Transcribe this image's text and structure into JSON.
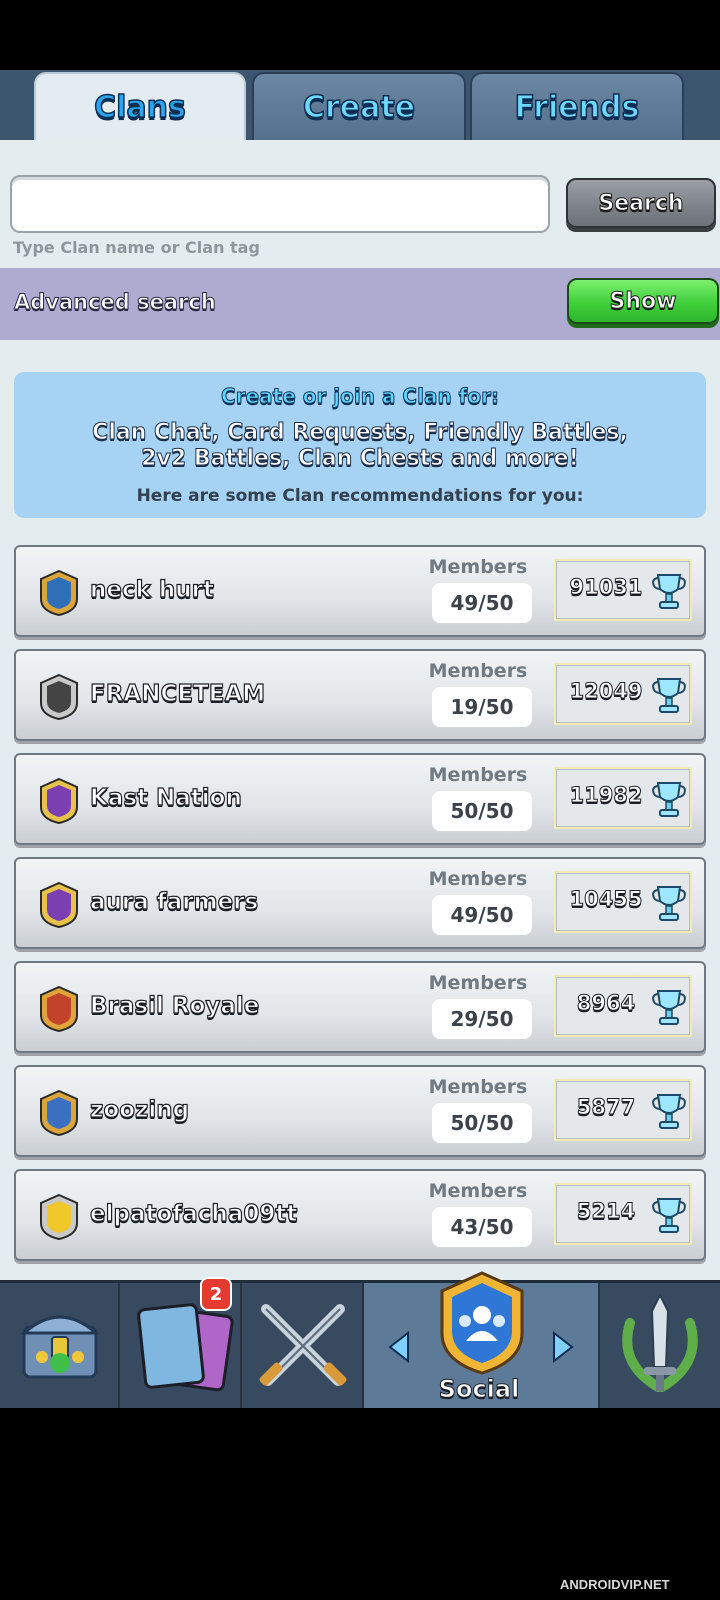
{
  "tabs": [
    {
      "label": "Clans",
      "active": true
    },
    {
      "label": "Create",
      "active": false
    },
    {
      "label": "Friends",
      "active": false
    }
  ],
  "search": {
    "value": "",
    "button_label": "Search",
    "hint": "Type Clan name or Clan tag"
  },
  "advanced": {
    "label": "Advanced search",
    "button_label": "Show"
  },
  "info": {
    "title": "Create or join a Clan for:",
    "line1": "Clan Chat, Card Requests, Friendly Battles,",
    "line2": "2v2 Battles, Clan Chests and more!",
    "sub": "Here are some Clan recommendations for you:"
  },
  "clans": [
    {
      "name": "neck hurt",
      "members_label": "Members",
      "members": "49/50",
      "trophies": "91031",
      "badge_icon": "blue-hammer-badge-icon"
    },
    {
      "name": "FRANCETEAM",
      "members_label": "Members",
      "members": "19/50",
      "trophies": "12049",
      "badge_icon": "helmet-badge-icon"
    },
    {
      "name": "Kast Nation",
      "members_label": "Members",
      "members": "50/50",
      "trophies": "11982",
      "badge_icon": "elixir-badge-icon"
    },
    {
      "name": "aura farmers",
      "members_label": "Members",
      "members": "49/50",
      "trophies": "10455",
      "badge_icon": "elixir-badge-icon"
    },
    {
      "name": "Brasil Royale",
      "members_label": "Members",
      "members": "29/50",
      "trophies": "8964",
      "badge_icon": "flag-badge-icon"
    },
    {
      "name": "zoozing",
      "members_label": "Members",
      "members": "50/50",
      "trophies": "5877",
      "badge_icon": "hammer-badge-icon"
    },
    {
      "name": "elpatofacha09tt",
      "members_label": "Members",
      "members": "43/50",
      "trophies": "5214",
      "badge_icon": "colombia-badge-icon"
    }
  ],
  "nav": {
    "items": [
      "chest-icon",
      "cards-icon",
      "battle-swords-icon",
      "social-icon",
      "sword-laurel-icon"
    ],
    "cards_badge": "2",
    "social_label": "Social"
  },
  "watermark": "ANDROIDVIP.NET",
  "colors": {
    "tab_text": "#6fd8ff",
    "content_bg": "#e3ecef",
    "show_green": "#3fcf3c",
    "info_bg": "#a6d2f3",
    "nav_bg": "#384a5f"
  }
}
